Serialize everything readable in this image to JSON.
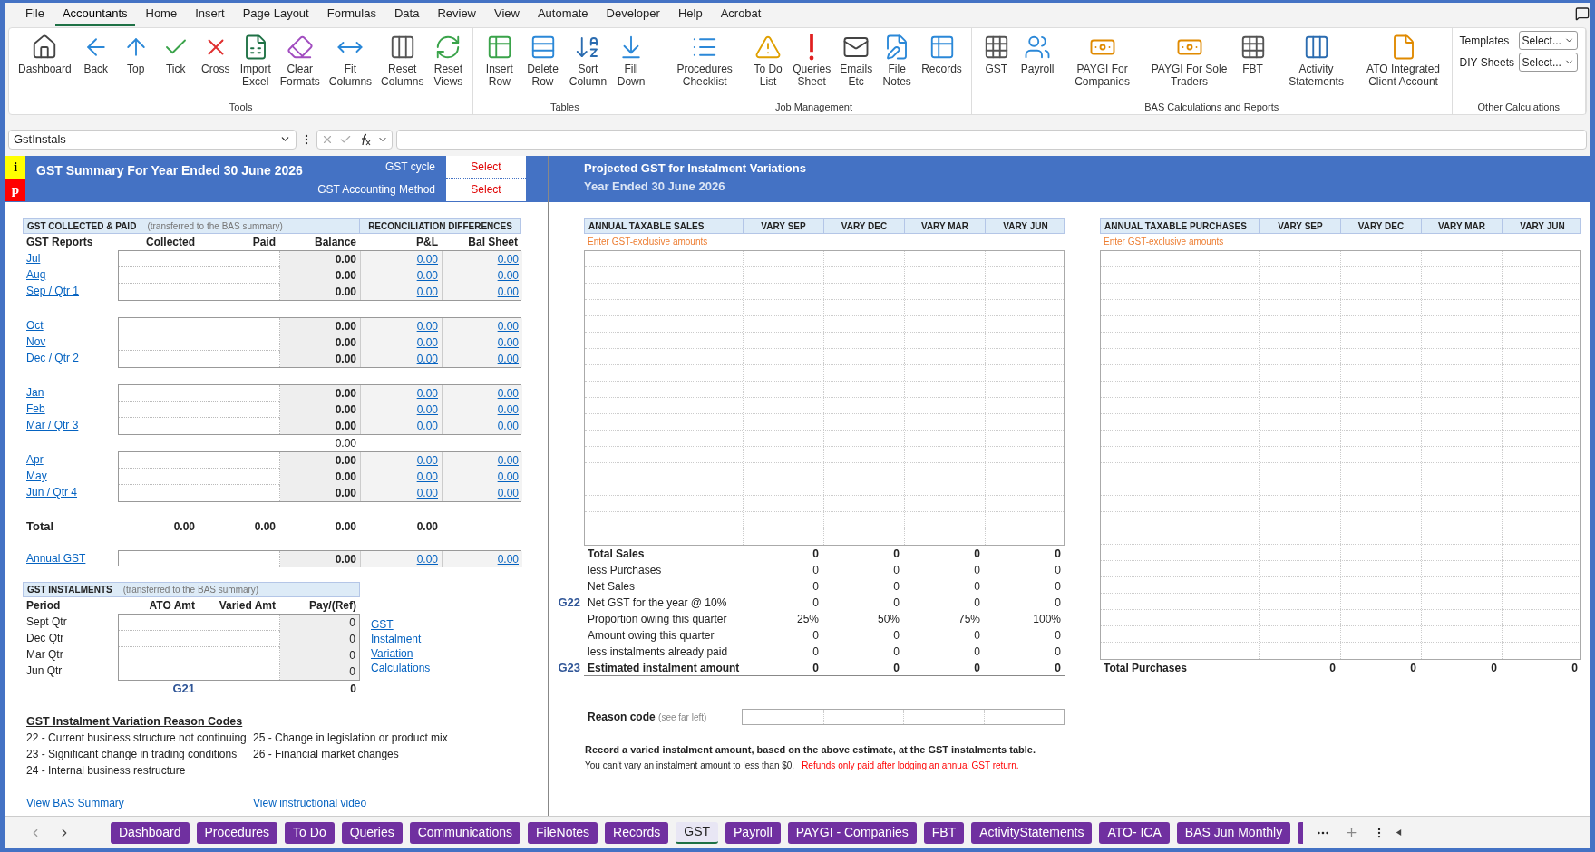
{
  "menu": [
    {
      "label": "File",
      "selected": false
    },
    {
      "label": "Accountants",
      "selected": true
    },
    {
      "label": "Home",
      "selected": false
    },
    {
      "label": "Insert",
      "selected": false
    },
    {
      "label": "Page Layout",
      "selected": false
    },
    {
      "label": "Formulas",
      "selected": false
    },
    {
      "label": "Data",
      "selected": false
    },
    {
      "label": "Review",
      "selected": false
    },
    {
      "label": "View",
      "selected": false
    },
    {
      "label": "Automate",
      "selected": false
    },
    {
      "label": "Developer",
      "selected": false
    },
    {
      "label": "Help",
      "selected": false
    },
    {
      "label": "Acrobat",
      "selected": false
    }
  ],
  "ribbon": {
    "groups": [
      {
        "label": "Tools",
        "buttons": [
          "Dashboard",
          "Back",
          "Top",
          "Tick",
          "Cross",
          "Import Excel",
          "Clear Formats",
          "Fit Columns",
          "Reset Columns",
          "Reset Views"
        ]
      },
      {
        "label": "Tables",
        "buttons": [
          "Insert Row",
          "Delete Row",
          "Sort Column",
          "Fill Down"
        ]
      },
      {
        "label": "Job Management",
        "buttons": [
          "Procedures Checklist",
          "To Do List",
          "Queries Sheet",
          "Emails Etc",
          "File Notes",
          "Records"
        ]
      },
      {
        "label": "BAS Calculations and Reports",
        "buttons": [
          "GST",
          "Payroll",
          "PAYGI For Companies",
          "PAYGI For Sole Traders",
          "FBT",
          "Activity Statements",
          "ATO Integrated Client Account"
        ]
      }
    ],
    "other": {
      "label": "Other Calculations",
      "dropdowns": [
        {
          "label": "Templates",
          "value": "Select..."
        },
        {
          "label": "DIY Sheets",
          "value": "Select..."
        }
      ]
    }
  },
  "formula_bar": {
    "name_box": "GstInstals"
  },
  "summary": {
    "info_buttons": [
      "i",
      "p"
    ],
    "title": "GST Summary For Year Ended 30 June 2026",
    "settings": [
      {
        "label": "GST cycle",
        "value": "Select"
      },
      {
        "label": "GST Accounting Method",
        "value": "Select"
      }
    ],
    "collected": {
      "title": "GST COLLECTED & PAID",
      "note": "(transferred to the BAS summary)",
      "recon_title": "RECONCILIATION DIFFERENCES",
      "columns": [
        "GST Reports",
        "Collected",
        "Paid",
        "Balance",
        "P&L",
        "Bal Sheet"
      ],
      "groups": [
        {
          "rows": [
            {
              "label": "Jul",
              "balance": "0.00",
              "pl": "0.00",
              "bal_sheet": "0.00"
            },
            {
              "label": "Aug",
              "balance": "0.00",
              "pl": "0.00",
              "bal_sheet": "0.00"
            },
            {
              "label": "Sep / Qtr 1",
              "balance": "0.00",
              "pl": "0.00",
              "bal_sheet": "0.00"
            }
          ]
        },
        {
          "rows": [
            {
              "label": "Oct",
              "balance": "0.00",
              "pl": "0.00",
              "bal_sheet": "0.00"
            },
            {
              "label": "Nov",
              "balance": "0.00",
              "pl": "0.00",
              "bal_sheet": "0.00"
            },
            {
              "label": "Dec / Qtr 2",
              "balance": "0.00",
              "pl": "0.00",
              "bal_sheet": "0.00"
            }
          ]
        },
        {
          "rows": [
            {
              "label": "Jan",
              "balance": "0.00",
              "pl": "0.00",
              "bal_sheet": "0.00"
            },
            {
              "label": "Feb",
              "balance": "0.00",
              "pl": "0.00",
              "bal_sheet": "0.00"
            },
            {
              "label": "Mar / Qtr 3",
              "balance": "0.00",
              "pl": "0.00",
              "bal_sheet": "0.00"
            }
          ],
          "extra_balance": "0.00"
        },
        {
          "rows": [
            {
              "label": "Apr",
              "balance": "0.00",
              "pl": "0.00",
              "bal_sheet": "0.00"
            },
            {
              "label": "May",
              "balance": "0.00",
              "pl": "0.00",
              "bal_sheet": "0.00"
            },
            {
              "label": "Jun / Qtr 4",
              "balance": "0.00",
              "pl": "0.00",
              "bal_sheet": "0.00"
            }
          ]
        }
      ],
      "total": {
        "label": "Total",
        "values": [
          "0.00",
          "0.00",
          "0.00",
          "0.00"
        ]
      },
      "annual": {
        "label": "Annual GST",
        "balance": "0.00",
        "pl": "0.00",
        "bal_sheet": "0.00"
      }
    },
    "instalments": {
      "title": "GST INSTALMENTS",
      "note": "(transferred to the BAS summary)",
      "columns": [
        "Period",
        "ATO Amt",
        "Varied Amt",
        "Pay/(Ref)"
      ],
      "rows": [
        {
          "period": "Sept Qtr",
          "pay": "0"
        },
        {
          "period": "Dec Qtr",
          "pay": "0"
        },
        {
          "period": "Mar Qtr",
          "pay": "0"
        },
        {
          "period": "Jun Qtr",
          "pay": "0"
        }
      ],
      "total": {
        "code": "G21",
        "value": "0"
      },
      "link": "GST Instalment Variation Calculations"
    },
    "reason_codes": {
      "title": "GST Instalment Variation Reason Codes",
      "columns": [
        [
          "22 - Current business structure not continuing",
          "23 - Significant change in trading conditions",
          "24 - Internal business restructure"
        ],
        [
          "25 - Change in legislation or product mix",
          "26 - Financial market changes"
        ]
      ]
    },
    "links": [
      "View BAS Summary",
      "View instructional video"
    ]
  },
  "projection": {
    "title": "Projected GST for Instalment Variations",
    "subtitle": "Year Ended 30 June 2026",
    "sales": {
      "columns": [
        "ANNUAL TAXABLE SALES",
        "VARY SEP",
        "VARY DEC",
        "VARY MAR",
        "VARY JUN"
      ],
      "note": "Enter GST-exclusive amounts",
      "rows": [
        {
          "label": "Total Sales",
          "values": [
            "0",
            "0",
            "0",
            "0"
          ],
          "bold": true
        },
        {
          "label": "less Purchases",
          "values": [
            "0",
            "0",
            "0",
            "0"
          ],
          "bold": false
        },
        {
          "label": "Net Sales",
          "values": [
            "0",
            "0",
            "0",
            "0"
          ],
          "bold": false
        },
        {
          "code": "G22",
          "label": "Net GST for the year @ 10%",
          "values": [
            "0",
            "0",
            "0",
            "0"
          ],
          "bold": false
        },
        {
          "label": "Proportion owing this quarter",
          "values": [
            "25%",
            "50%",
            "75%",
            "100%"
          ],
          "bold": false
        },
        {
          "label": "Amount owing this quarter",
          "values": [
            "0",
            "0",
            "0",
            "0"
          ],
          "bold": false
        },
        {
          "label": "less instalments already paid",
          "values": [
            "0",
            "0",
            "0",
            "0"
          ],
          "bold": false
        },
        {
          "code": "G23",
          "label": "Estimated instalment amount",
          "values": [
            "0",
            "0",
            "0",
            "0"
          ],
          "bold": true
        }
      ]
    },
    "reason": {
      "label": "Reason code",
      "hint": "(see far left)"
    },
    "instruction": "Record a varied instalment amount, based on the above estimate, at the GST instalments table.",
    "caveat": "You can't vary an instalment amount to less than $0.",
    "warning": "Refunds only paid after lodging an annual GST return.",
    "purchases": {
      "columns": [
        "ANNUAL TAXABLE PURCHASES",
        "VARY SEP",
        "VARY DEC",
        "VARY MAR",
        "VARY JUN"
      ],
      "note": "Enter GST-exclusive amounts",
      "total": {
        "label": "Total Purchases",
        "values": [
          "0",
          "0",
          "0",
          "0"
        ]
      }
    }
  },
  "sheet_tabs": [
    {
      "label": "Dashboard",
      "selected": false
    },
    {
      "label": "Procedures",
      "selected": false
    },
    {
      "label": "To Do",
      "selected": false
    },
    {
      "label": "Queries",
      "selected": false
    },
    {
      "label": "Communications",
      "selected": false
    },
    {
      "label": "FileNotes",
      "selected": false
    },
    {
      "label": "Records",
      "selected": false
    },
    {
      "label": "GST",
      "selected": true
    },
    {
      "label": "Payroll",
      "selected": false
    },
    {
      "label": "PAYGI - Companies",
      "selected": false
    },
    {
      "label": "FBT",
      "selected": false
    },
    {
      "label": "ActivityStatements",
      "selected": false
    },
    {
      "label": "ATO- ICA",
      "selected": false
    },
    {
      "label": "BAS Jun Monthly",
      "selected": false
    }
  ]
}
